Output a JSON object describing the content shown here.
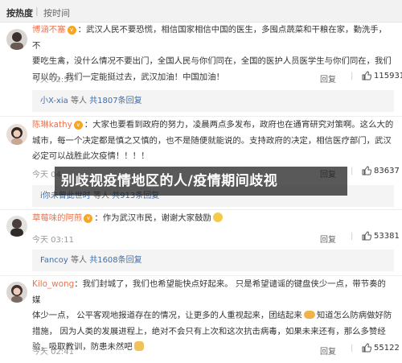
{
  "sort": {
    "hot": "按热度",
    "separator": "|",
    "time": "按时间"
  },
  "comments": [
    {
      "username": "博涵不塞",
      "text_lines": [
        "：武汉人民不要恐慌，相信国家相信中国的医生，多囤点蔬菜和干粮在家，勤洗手，不",
        "要吃生禽，没什么情况不要出门，全国人民与你们同在，全国的医护人员医学生与你们同在，我们",
        "可以的，我们一定能挺过去，武汉加油！中国加油！"
      ],
      "time": "今天 02:53",
      "reply": "回复",
      "likes": "115931",
      "sub_user": "小X-xia",
      "sub_mid": " 等人 ",
      "sub_count": "共1807条回复"
    },
    {
      "username": "陈琳kathy",
      "text_lines": [
        "：大家也要看到政府的努力，凌晨两点多发布，政府也在通宵研究对策啊。这么大的",
        "城市，每一个决定都是慎之又慎的，也不是随便就能说的。支持政府的决定，相信医疗部门，武汉",
        "必定可以战胜此次疫情！！！！"
      ],
      "time": "今天 04",
      "reply": "回复",
      "likes": "83637",
      "sub_user": "i你未曾此世时",
      "sub_mid": " 等人 ",
      "sub_count": "共913条回复"
    },
    {
      "username": "草莓味的阿煎",
      "text_lines": [
        "：作为武汉市民，谢谢大家鼓励"
      ],
      "time": "今天 03:11",
      "reply": "回复",
      "likes": "53381",
      "sub_user": "Fancoy",
      "sub_mid": " 等人 ",
      "sub_count": "共1608条回复"
    },
    {
      "username": "Kilo_wong",
      "text_lines": [
        "：我们封城了，我们也希望能快点好起来。 只是希望谴谣的键盘侠少一点，带节奏的媒",
        "体少一点， 公平客观地报道存在的情况，让更多的人重视起来，团结起来",
        "措施， 因为人类的发展进程上，绝对不会只有上次和这次抗击病毒，如果未来还有，那么多赞经",
        "验，吸取教训，防患未然吧"
      ],
      "inline_after_line2": "知道怎么防病做好防",
      "time": "今天 02:41",
      "reply": "回复",
      "likes": "55122"
    }
  ],
  "banner": "别歧视疫情地区的人/疫情期间歧视",
  "colors": {
    "accent": "#eb7350",
    "link": "#3a6fb0",
    "muted": "#999999",
    "banner_bg": "#191919"
  }
}
